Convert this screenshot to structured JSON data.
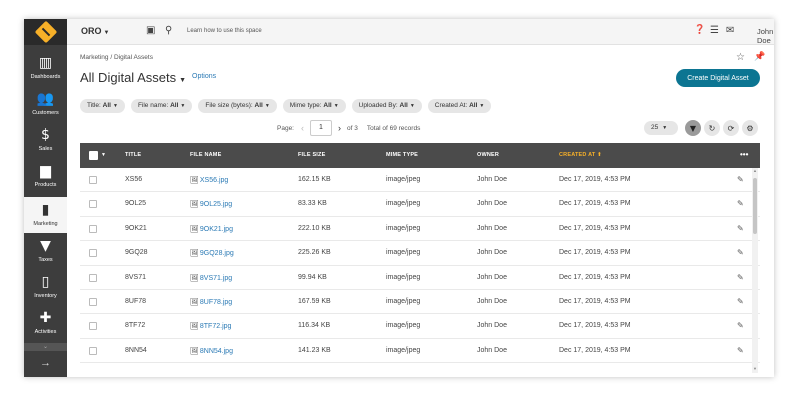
{
  "topbar": {
    "org_name": "ORO",
    "learn_text": "Learn how to use this space",
    "user_name": "John Doe"
  },
  "sidebar": {
    "items": [
      {
        "label": "Dashboards",
        "icon": "bar-chart-icon",
        "glyph": "▥"
      },
      {
        "label": "Customers",
        "icon": "users-icon",
        "glyph": "👥"
      },
      {
        "label": "Sales",
        "icon": "dollar-icon",
        "glyph": "$"
      },
      {
        "label": "Products",
        "icon": "briefcase-icon",
        "glyph": "▆"
      },
      {
        "label": "Marketing",
        "icon": "book-icon",
        "glyph": "▮"
      },
      {
        "label": "Taxes",
        "icon": "filter-icon",
        "glyph": "▼"
      },
      {
        "label": "Inventory",
        "icon": "tablet-icon",
        "glyph": "▯"
      },
      {
        "label": "Activities",
        "icon": "puzzle-icon",
        "glyph": "✚"
      }
    ],
    "active": "Marketing"
  },
  "header": {
    "breadcrumb": "Marketing / Digital Assets",
    "title": "All Digital Assets",
    "options_label": "Options",
    "create_button": "Create Digital Asset"
  },
  "filters": [
    {
      "name": "Title:",
      "value": "All"
    },
    {
      "name": "File name:",
      "value": "All"
    },
    {
      "name": "File size (bytes):",
      "value": "All"
    },
    {
      "name": "Mime type:",
      "value": "All"
    },
    {
      "name": "Uploaded By:",
      "value": "All"
    },
    {
      "name": "Created At:",
      "value": "All"
    }
  ],
  "pager": {
    "page_label": "Page:",
    "current_page": "1",
    "of_label": "of 3",
    "total_label": "Total of 69 records",
    "per_page": "25"
  },
  "grid": {
    "columns": [
      "TITLE",
      "FILE NAME",
      "FILE SIZE",
      "MIME TYPE",
      "OWNER",
      "CREATED AT"
    ],
    "sorted_column": "CREATED AT",
    "actions_label": "•••",
    "rows": [
      {
        "title": "XS56",
        "file_name": "XS56.jpg",
        "file_size": "162.15 KB",
        "mime_type": "image/jpeg",
        "owner": "John Doe",
        "created_at": "Dec 17, 2019, 4:53 PM"
      },
      {
        "title": "9OL25",
        "file_name": "9OL25.jpg",
        "file_size": "83.33 KB",
        "mime_type": "image/jpeg",
        "owner": "John Doe",
        "created_at": "Dec 17, 2019, 4:53 PM"
      },
      {
        "title": "9OK21",
        "file_name": "9OK21.jpg",
        "file_size": "222.10 KB",
        "mime_type": "image/jpeg",
        "owner": "John Doe",
        "created_at": "Dec 17, 2019, 4:53 PM"
      },
      {
        "title": "9GQ28",
        "file_name": "9GQ28.jpg",
        "file_size": "225.26 KB",
        "mime_type": "image/jpeg",
        "owner": "John Doe",
        "created_at": "Dec 17, 2019, 4:53 PM"
      },
      {
        "title": "8VS71",
        "file_name": "8VS71.jpg",
        "file_size": "99.94 KB",
        "mime_type": "image/jpeg",
        "owner": "John Doe",
        "created_at": "Dec 17, 2019, 4:53 PM"
      },
      {
        "title": "8UF78",
        "file_name": "8UF78.jpg",
        "file_size": "167.59 KB",
        "mime_type": "image/jpeg",
        "owner": "John Doe",
        "created_at": "Dec 17, 2019, 4:53 PM"
      },
      {
        "title": "8TF72",
        "file_name": "8TF72.jpg",
        "file_size": "116.34 KB",
        "mime_type": "image/jpeg",
        "owner": "John Doe",
        "created_at": "Dec 17, 2019, 4:53 PM"
      },
      {
        "title": "8NN54",
        "file_name": "8NN54.jpg",
        "file_size": "141.23 KB",
        "mime_type": "image/jpeg",
        "owner": "John Doe",
        "created_at": "Dec 17, 2019, 4:53 PM"
      }
    ]
  },
  "colors": {
    "accent": "#0c7592",
    "sidebar_bg": "#3d3d3d",
    "grid_header_bg": "#4b4b4b",
    "sorted_column": "#f7b028",
    "link": "#2b7ab5"
  }
}
